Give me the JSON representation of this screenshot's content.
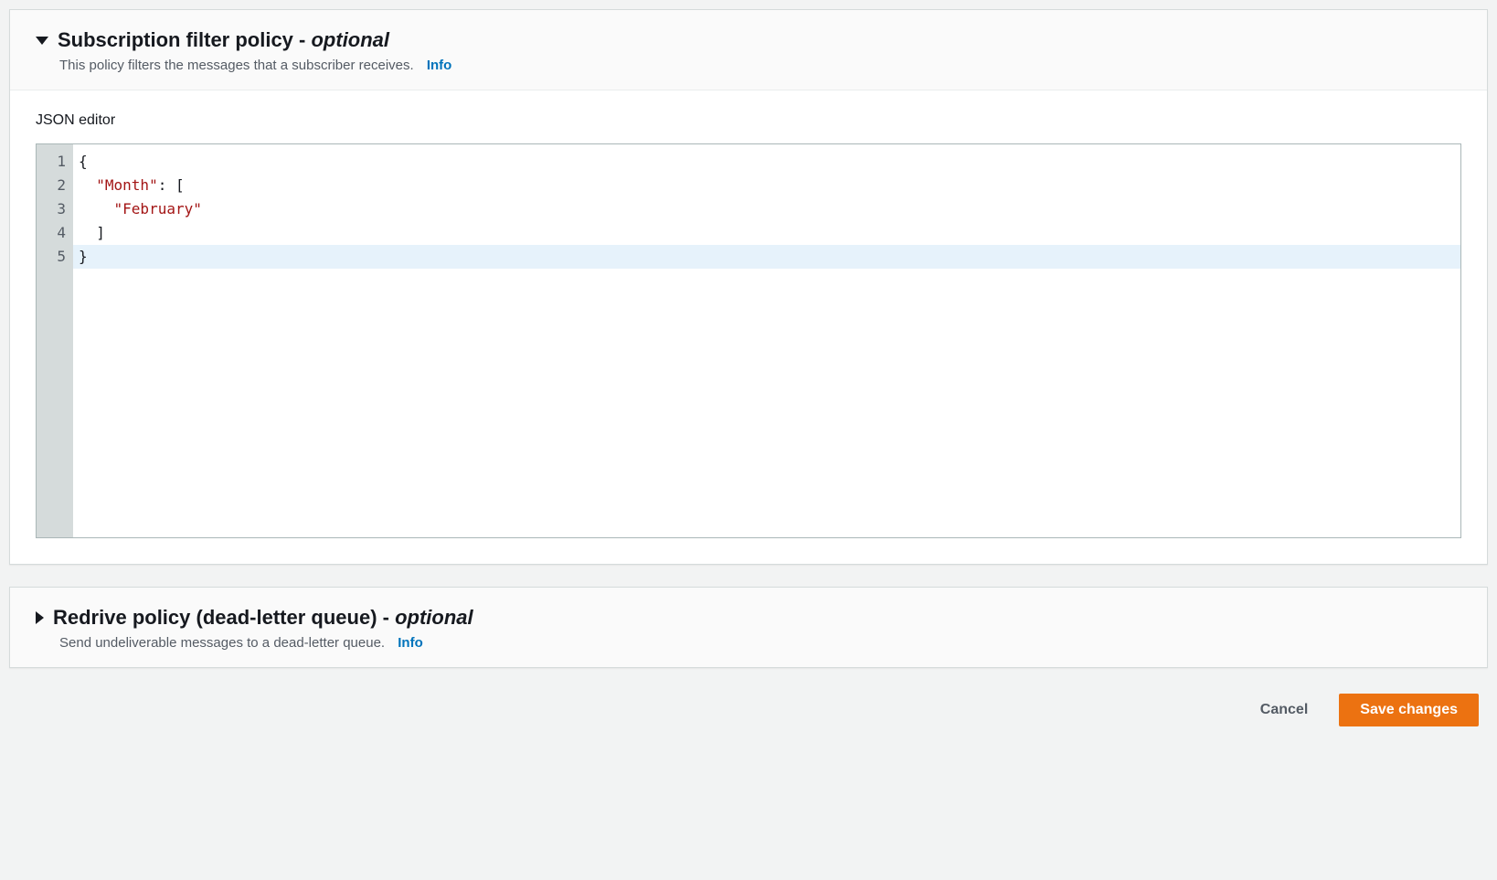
{
  "panel1": {
    "title_main": "Subscription filter policy - ",
    "title_optional": "optional",
    "description": "This policy filters the messages that a subscriber receives.",
    "info": "Info",
    "editor_label": "JSON editor",
    "code": {
      "line1": "{",
      "line2_indent": "  ",
      "line2_key": "\"Month\"",
      "line2_after": ": [",
      "line3_indent": "    ",
      "line3_str": "\"February\"",
      "line4": "  ]",
      "line5": "}"
    },
    "gutter": [
      "1",
      "2",
      "3",
      "4",
      "5"
    ]
  },
  "panel2": {
    "title_main": "Redrive policy (dead-letter queue) - ",
    "title_optional": "optional",
    "description": "Send undeliverable messages to a dead-letter queue.",
    "info": "Info"
  },
  "actions": {
    "cancel": "Cancel",
    "save": "Save changes"
  }
}
